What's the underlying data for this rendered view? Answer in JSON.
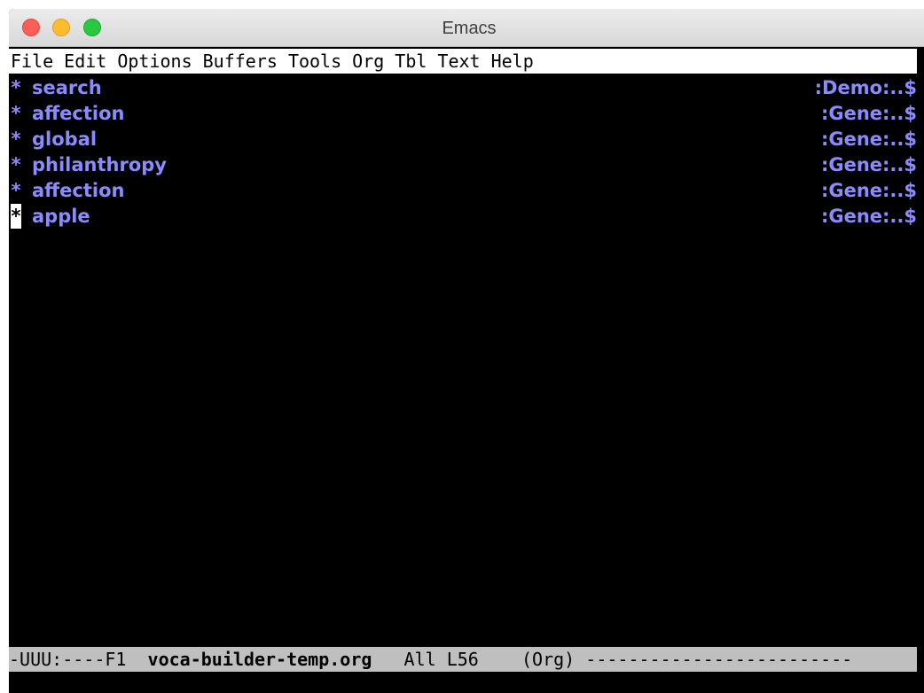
{
  "window": {
    "title": "Emacs"
  },
  "menubar": {
    "items": [
      "File",
      "Edit",
      "Options",
      "Buffers",
      "Tools",
      "Org",
      "Tbl",
      "Text",
      "Help"
    ]
  },
  "buffer": {
    "lines": [
      {
        "bullet": "*",
        "heading": "search",
        "tags": ":Demo:..$"
      },
      {
        "bullet": "*",
        "heading": "affection",
        "tags": ":Gene:..$"
      },
      {
        "bullet": "*",
        "heading": "global",
        "tags": ":Gene:..$"
      },
      {
        "bullet": "*",
        "heading": "philanthropy",
        "tags": ":Gene:..$"
      },
      {
        "bullet": "*",
        "heading": "affection",
        "tags": ":Gene:..$"
      },
      {
        "bullet": "*",
        "heading": "apple",
        "tags": ":Gene:..$"
      }
    ],
    "cursor_line": 6
  },
  "modeline": {
    "status": "-UUU:----F1",
    "buffer_name": "voca-builder-temp.org",
    "position": "All L56",
    "mode": "(Org)",
    "fill": "-------------------------"
  },
  "colors": {
    "heading": "#8b8bff",
    "modeline_bg": "#bfbfbf",
    "buffer_bg": "#000000"
  }
}
